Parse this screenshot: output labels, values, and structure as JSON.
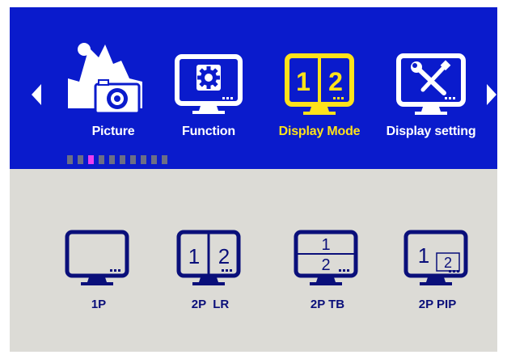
{
  "menu": {
    "items": [
      {
        "label": "Picture",
        "icon": "picture-icon",
        "selected": false
      },
      {
        "label": "Function",
        "icon": "gear-icon",
        "selected": false
      },
      {
        "label": "Display Mode",
        "icon": "split-screen-icon",
        "selected": true
      },
      {
        "label": "Display setting",
        "icon": "tools-icon",
        "selected": false
      }
    ],
    "active_color": "#ffe21a",
    "background_color": "#0a1bcc",
    "page_indicator": {
      "count": 10,
      "active_index": 2
    }
  },
  "display_modes": {
    "items": [
      {
        "label": "1P",
        "icon": "single-monitor-icon"
      },
      {
        "label": "2P  LR",
        "icon": "monitor-left-right-icon",
        "pane_1": "1",
        "pane_2": "2"
      },
      {
        "label": "2P TB",
        "icon": "monitor-top-bottom-icon",
        "pane_1": "1",
        "pane_2": "2"
      },
      {
        "label": "2P PIP",
        "icon": "monitor-pip-icon",
        "pane_1": "1",
        "pane_2": "2"
      }
    ],
    "icon_color": "#0a0f7a"
  }
}
